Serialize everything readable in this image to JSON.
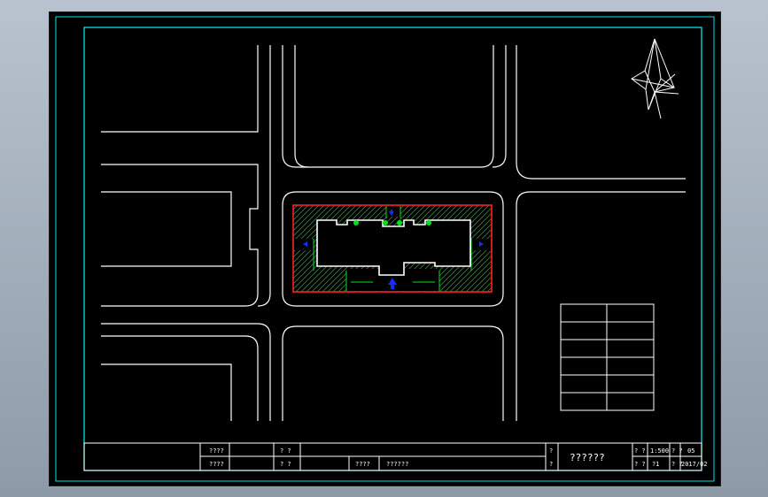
{
  "drawing": {
    "title_block": {
      "r1c1": "????",
      "r1c2": "? ?",
      "r2c1": "????",
      "r2c2": "? ?",
      "r2c3": "????",
      "r2c4": "??????",
      "r1_mid": "?",
      "r2_mid": "?",
      "project_title": "??????",
      "r1_a": "? ?",
      "r1_b": "1:500",
      "r1_c": "? ?",
      "r1_d": "05",
      "r2_a": "? ?",
      "r2_b": "?1",
      "r2_c": "? ?",
      "r2_d": "2017/02"
    }
  },
  "colors": {
    "frame": "#00e5e5",
    "road": "#ffffff",
    "site_boundary": "#ff2020",
    "green": "#00e020",
    "arrow": "#1030ff"
  }
}
